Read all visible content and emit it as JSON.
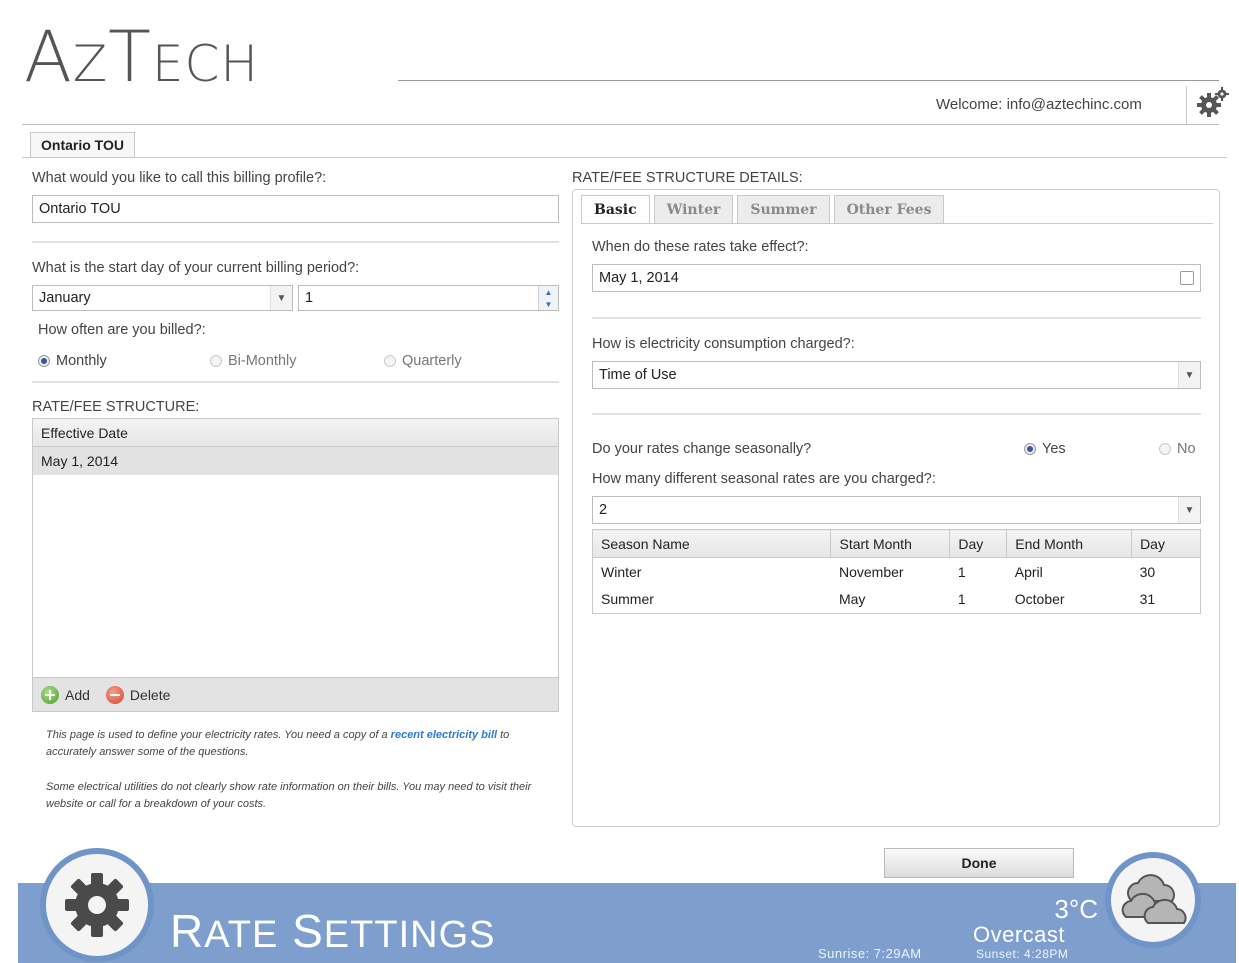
{
  "app": {
    "logo_big": "A",
    "logo_rest_z": "Z",
    "logo_rest_t": "T",
    "logo_rest_ech": "ECH",
    "welcome": "Welcome: info@aztechinc.com"
  },
  "profile_tab": "Ontario TOU",
  "left": {
    "profile_name_label": "What would you like to call this billing profile?:",
    "profile_name_value": "Ontario TOU",
    "start_day_label": "What is the start day of your current billing period?:",
    "start_month_value": "January",
    "start_day_value": "1",
    "billing_freq_label": "How often are you billed?:",
    "freq_monthly": "Monthly",
    "freq_bimonthly": "Bi-Monthly",
    "freq_quarterly": "Quarterly",
    "freq_selected": "Monthly",
    "rate_structure_label": "RATE/FEE STRUCTURE:",
    "grid_header": "Effective Date",
    "grid_rows": [
      "May 1, 2014"
    ],
    "add_label": "Add",
    "delete_label": "Delete",
    "note1_pre": "This page is used to define your electricity rates. You need a copy of a ",
    "note1_link": "recent electricity bill",
    "note1_post": " to accurately answer some of the questions.",
    "note2": "Some electrical utilities do not clearly show rate information on their bills. You may need to visit their website or call for a breakdown of your costs."
  },
  "right": {
    "details_label": "RATE/FEE STRUCTURE DETAILS:",
    "tabs": [
      "Basic",
      "Winter",
      "Summer",
      "Other Fees"
    ],
    "active_tab": "Basic",
    "effect_label": "When do these rates take effect?:",
    "effect_value": "May 1, 2014",
    "charged_label": "How is electricity consumption charged?:",
    "charged_value": "Time of Use",
    "seasonal_label": "Do your rates change seasonally?",
    "seasonal_yes": "Yes",
    "seasonal_no": "No",
    "seasonal_selected": "Yes",
    "num_seasons_label": "How many different seasonal rates are you charged?:",
    "num_seasons_value": "2",
    "season_table": {
      "headers": [
        "Season Name",
        "Start Month",
        "Day",
        "End Month",
        "Day"
      ],
      "rows": [
        [
          "Winter",
          "November",
          "1",
          "April",
          "30"
        ],
        [
          "Summer",
          "May",
          "1",
          "October",
          "31"
        ]
      ]
    }
  },
  "done_label": "Done",
  "footer": {
    "title_r": "R",
    "title_ate": "ATE",
    "title_s": "S",
    "title_ettings": "ETTINGS",
    "sunrise": "Sunrise: 7:29AM",
    "sunset": "Sunset: 4:28PM",
    "temperature": "3°C",
    "condition": "Overcast"
  },
  "colors": {
    "footer_bar": "#7e9fce",
    "link": "#2b7bd0",
    "radio_on": "#3558a0"
  }
}
